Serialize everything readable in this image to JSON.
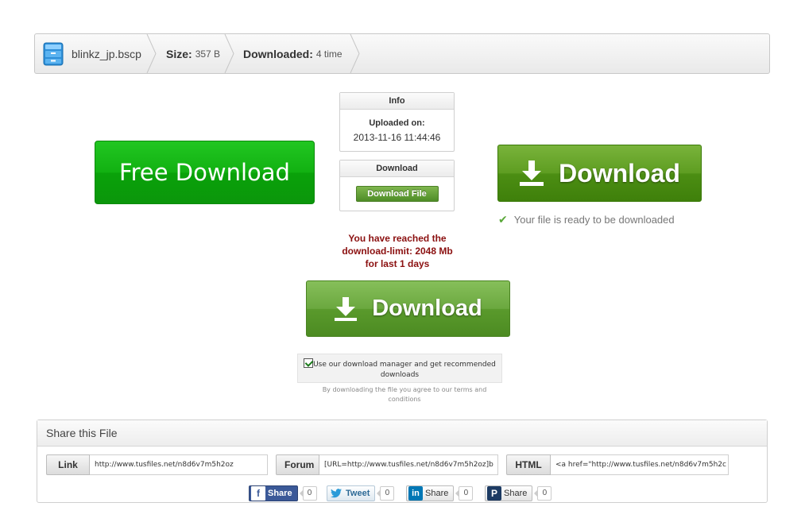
{
  "file": {
    "name": "blinkz_jp.bscp",
    "size_label": "Size:",
    "size_value": "357 B",
    "downloaded_label": "Downloaded:",
    "downloaded_value": "4 time"
  },
  "info_box": {
    "title": "Info",
    "uploaded_label": "Uploaded on:",
    "uploaded_value": "2013-11-16 11:44:46"
  },
  "download_box": {
    "title": "Download",
    "button_label": "Download File"
  },
  "buttons": {
    "free_download": "Free Download",
    "download_right": "Download",
    "download_center": "Download"
  },
  "ready_text": "Your file is ready to be downloaded",
  "limit_message": "You have reached the download-limit: 2048 Mb for last 1 days",
  "manager": {
    "checked": true,
    "text": "Use our download manager and get recommended downloads"
  },
  "terms_text": "By downloading the file you agree to our terms and conditions",
  "share": {
    "title": "Share this File",
    "link_label": "Link",
    "link_value": "http://www.tusfiles.net/n8d6v7m5h2oz",
    "forum_label": "Forum",
    "forum_value": "[URL=http://www.tusfiles.net/n8d6v7m5h2oz]b",
    "html_label": "HTML",
    "html_value": "<a href=\"http://www.tusfiles.net/n8d6v7m5h2c"
  },
  "social": [
    {
      "label": "Share",
      "count": "0",
      "network": "facebook",
      "color": "#3b5998"
    },
    {
      "label": "Tweet",
      "count": "0",
      "network": "twitter",
      "color": "#2b9bd8"
    },
    {
      "label": "Share",
      "count": "0",
      "network": "linkedin",
      "color": "#0077b5"
    },
    {
      "label": "Share",
      "count": "0",
      "network": "pinterest",
      "color": "#cb2027"
    }
  ],
  "colors": {
    "free_green": "#12b112",
    "download_green": "#5e9d21",
    "limit_red": "#8b1010"
  }
}
